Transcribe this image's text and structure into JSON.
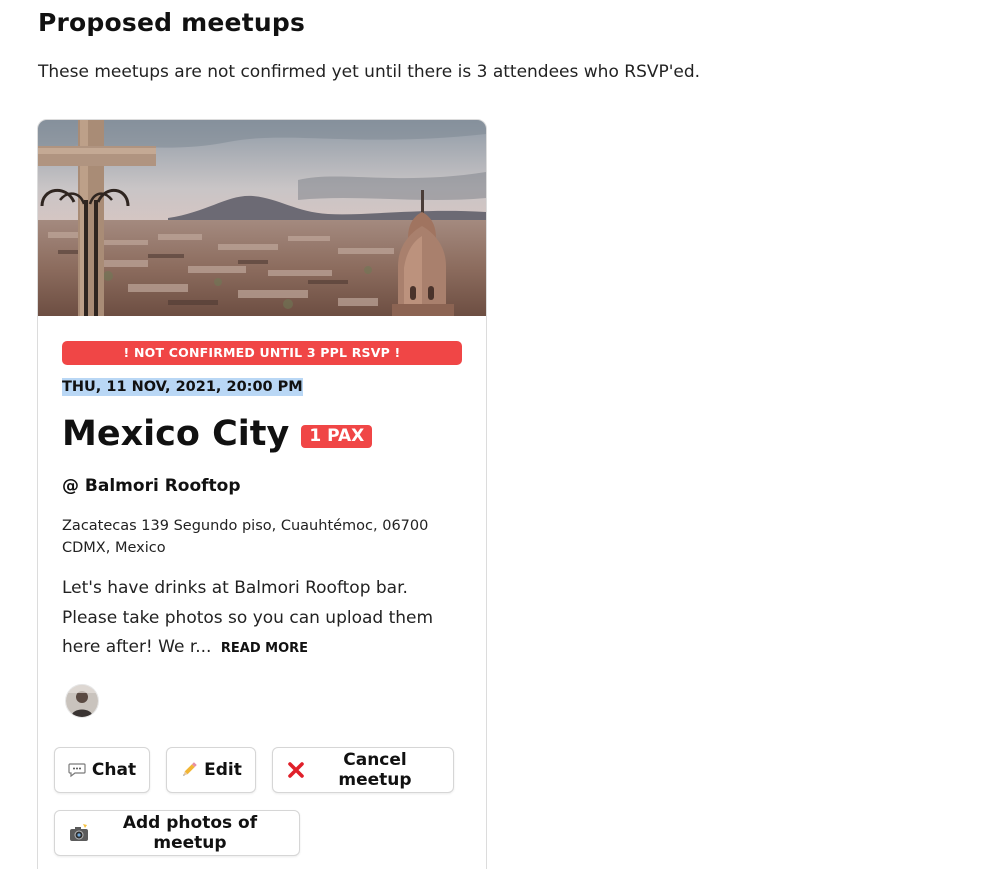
{
  "page": {
    "heading": "Proposed meetups",
    "intro": "These meetups are not confirmed yet until there is 3 attendees who RSVP'ed."
  },
  "meetup": {
    "banner": "! NOT CONFIRMED UNTIL 3 PPL RSVP !",
    "datetime": "THU, 11 NOV, 2021, 20:00 PM",
    "city": "Mexico City",
    "pax": "1 PAX",
    "venue": "@ Balmori Rooftop",
    "address": "Zacatecas 139 Segundo piso, Cuauhtémoc, 06700 CDMX, Mexico",
    "description": "Let's have drinks at Balmori Rooftop bar. Please take photos so you can upload them here after! We r...",
    "read_more": "READ MORE"
  },
  "actions": {
    "chat_label": "Chat",
    "chat_icon": "speech-bubble-icon",
    "edit_label": "Edit",
    "edit_icon": "pencil-icon",
    "cancel_label": "Cancel meetup",
    "cancel_icon": "red-x-icon",
    "photos_label": "Add photos of meetup",
    "photos_icon": "camera-flash-icon"
  },
  "colors": {
    "alert_red": "#f04646",
    "selection_blue": "#b9d7f5"
  }
}
